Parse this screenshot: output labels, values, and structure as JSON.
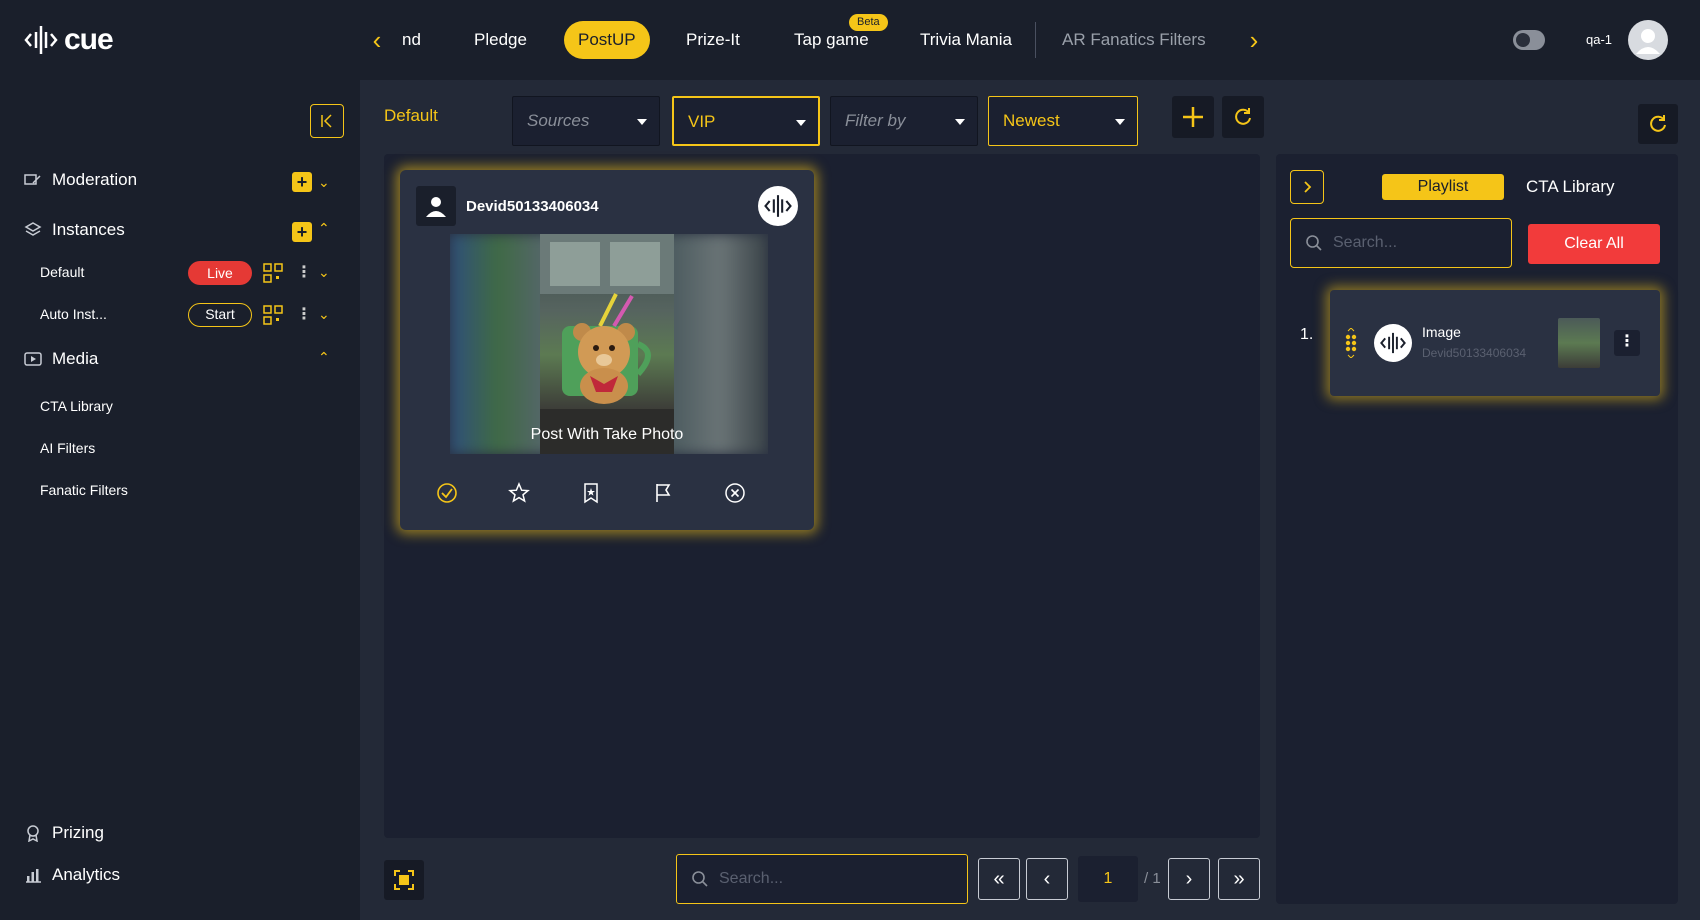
{
  "brand": {
    "logo_text": "cue"
  },
  "topnav": {
    "tabs": [
      {
        "label": "nd"
      },
      {
        "label": "Pledge"
      },
      {
        "label": "PostUP"
      },
      {
        "label": "Prize-It"
      },
      {
        "label": "Tap game"
      },
      {
        "label": "Trivia Mania"
      },
      {
        "label": "AR Fanatics Filters"
      }
    ],
    "beta_badge": "Beta",
    "username": "qa-1"
  },
  "sidebar": {
    "moderation": "Moderation",
    "instances": "Instances",
    "instance_list": [
      {
        "name": "Default",
        "status": "Live"
      },
      {
        "name": "Auto Inst...",
        "status": "Start"
      }
    ],
    "media": "Media",
    "media_items": [
      "CTA Library",
      "AI Filters",
      "Fanatic Filters"
    ],
    "prizing": "Prizing",
    "analytics": "Analytics"
  },
  "filters": {
    "breadcrumb": "Default",
    "sources_placeholder": "Sources",
    "vip_value": "VIP",
    "filter_by_placeholder": "Filter by",
    "sort_value": "Newest"
  },
  "post": {
    "username": "Devid50133406034",
    "caption": "Post With Take Photo"
  },
  "bottom": {
    "search_placeholder": "Search...",
    "page": "1",
    "total_pages": "/ 1"
  },
  "panel": {
    "tab_playlist": "Playlist",
    "tab_cta": "CTA Library",
    "search_placeholder": "Search...",
    "clear_all": "Clear All",
    "items": [
      {
        "index": "1.",
        "title": "Image",
        "user": "Devid50133406034"
      }
    ]
  },
  "colors": {
    "accent": "#f5c518",
    "danger": "#e53935",
    "bg": "#1a1f2b",
    "panel": "#232937"
  }
}
